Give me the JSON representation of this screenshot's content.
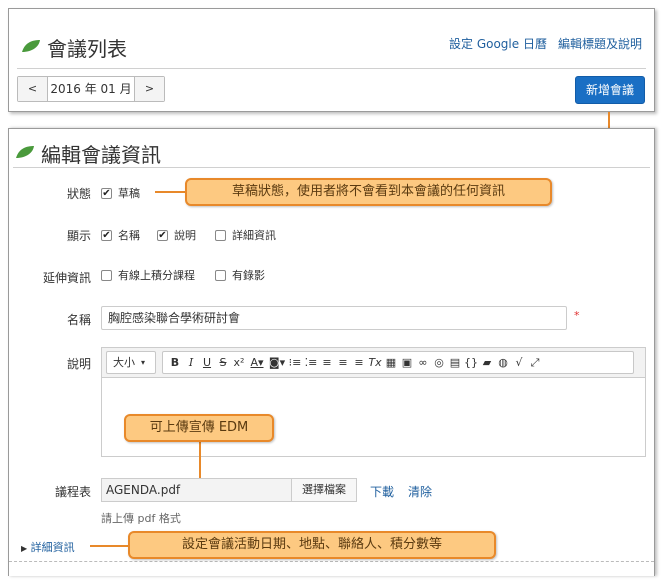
{
  "header": {
    "title": "會議列表",
    "links": [
      "設定 Google 日曆",
      "編輯標題及說明"
    ],
    "month_nav": {
      "prev": "<",
      "value": "2016 年 01 月",
      "next": ">"
    },
    "add_button": "新增會議"
  },
  "form": {
    "title": "編輯會議資訊",
    "status": {
      "label": "狀態",
      "option": "草稿",
      "checked": true
    },
    "display": {
      "label": "顯示",
      "options": [
        {
          "label": "名稱",
          "checked": true
        },
        {
          "label": "說明",
          "checked": true
        },
        {
          "label": "詳細資訊",
          "checked": false
        }
      ]
    },
    "extension": {
      "label": "延伸資訊",
      "options": [
        {
          "label": "有線上積分課程",
          "checked": false
        },
        {
          "label": "有錄影",
          "checked": false
        }
      ]
    },
    "name": {
      "label": "名稱",
      "value": "胸腔感染聯合學術研討會",
      "required": "*"
    },
    "description": {
      "label": "說明",
      "font_size": "大小"
    },
    "agenda": {
      "label": "議程表",
      "file": "AGENDA.pdf",
      "choose_button": "選擇檔案",
      "download": "下載",
      "clear": "清除",
      "hint": "請上傳 pdf 格式"
    },
    "details_toggle": "詳細資訊"
  },
  "callouts": {
    "draft": "草稿狀態，使用者將不會看到本會議的任何資訊",
    "edm": "可上傳宣傳 EDM",
    "details": "設定會議活動日期、地點、聯絡人、積分數等"
  },
  "colors": {
    "accent": "#1a6fc4",
    "link": "#1f5f9e",
    "callout_bg": "#fdc981",
    "callout_border": "#e8892a",
    "leaf": "#4a9a3c"
  }
}
